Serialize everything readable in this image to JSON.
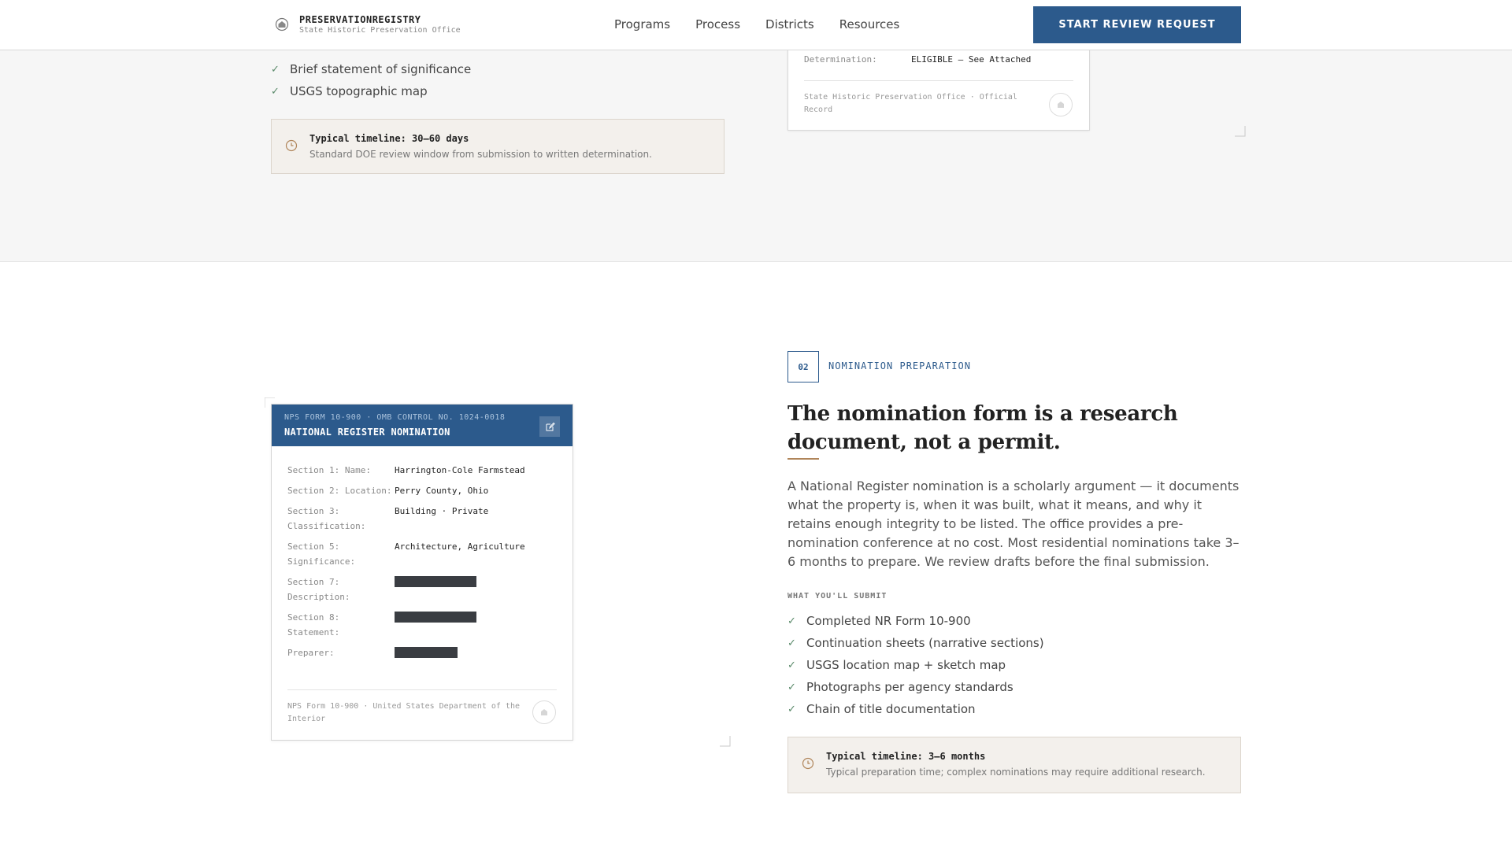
{
  "header": {
    "brand_name": "PRESERVATIONREGISTRY",
    "brand_sub": "State Historic Preservation Office",
    "nav": [
      "Programs",
      "Process",
      "Districts",
      "Resources"
    ],
    "cta_label": "START REVIEW REQUEST"
  },
  "top": {
    "checklist": [
      "Brief statement of significance",
      "USGS topographic map"
    ],
    "timeline_title": "Typical timeline: 30–60 days",
    "timeline_desc": "Standard DOE review window from submission to written determination.",
    "record": {
      "label": "Determination:",
      "value": "ELIGIBLE — See Attached",
      "footer": "State Historic Preservation Office · Official Record"
    }
  },
  "form_card": {
    "subtitle": "NPS FORM 10-900 · OMB CONTROL NO. 1024-0018",
    "title": "NATIONAL REGISTER NOMINATION",
    "rows": [
      {
        "label": "Section 1: Name:",
        "value": "Harrington-Cole Farmstead"
      },
      {
        "label": "Section 2: Location:",
        "value": "Perry County, Ohio"
      },
      {
        "label": "Section 3: Classification:",
        "value": "Building · Private"
      },
      {
        "label": "Section 5: Significance:",
        "value": "Architecture, Agriculture"
      },
      {
        "label": "Section 7: Description:",
        "value": ""
      },
      {
        "label": "Section 8: Statement:",
        "value": ""
      },
      {
        "label": "Preparer:",
        "value": ""
      }
    ],
    "footer": "NPS Form 10-900 · United States Department of the Interior"
  },
  "step": {
    "number": "02",
    "label": "NOMINATION PREPARATION",
    "headline": "The nomination form is a research document, not a permit.",
    "body": "A National Register nomination is a scholarly argument — it documents what the property is, when it was built, what it means, and why it retains enough integrity to be listed. The office provides a pre-nomination conference at no cost. Most residential nominations take 3–6 months to prepare. We review drafts before the final submission.",
    "submit_label": "WHAT YOU'LL SUBMIT",
    "submit_items": [
      "Completed NR Form 10-900",
      "Continuation sheets (narrative sections)",
      "USGS location map + sketch map",
      "Photographs per agency standards",
      "Chain of title documentation"
    ],
    "timeline_title": "Typical timeline: 3–6 months",
    "timeline_desc": "Typical preparation time; complex nominations may require additional research."
  },
  "colors": {
    "accent": "#2c5a8c",
    "timeline_bg": "#f3f0ec",
    "copper": "#b0855a"
  }
}
